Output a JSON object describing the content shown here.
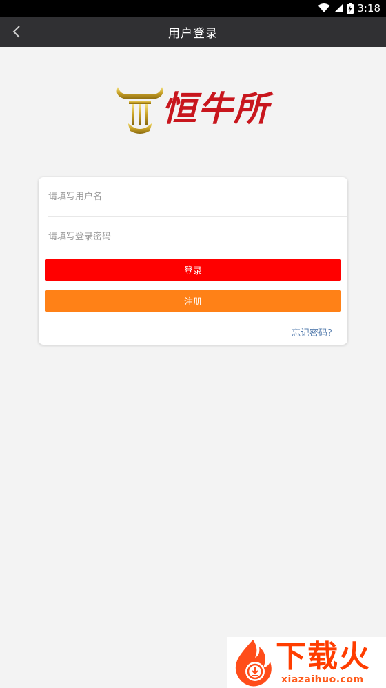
{
  "status_bar": {
    "time": "3:18"
  },
  "nav": {
    "title": "用户登录"
  },
  "brand": {
    "logo_text": "恒牛所"
  },
  "login_form": {
    "username_placeholder": "请填写用户名",
    "password_placeholder": "请填写登录密码",
    "login_label": "登录",
    "register_label": "注册",
    "forgot_label": "忘记密码？"
  },
  "watermark": {
    "cn": "下载火",
    "en": "xiazaihuo.com"
  },
  "colors": {
    "navbar": "#303033",
    "login_button": "#ff0000",
    "register_button": "#ff8117",
    "link": "#5a80b0",
    "logo_red": "#c8161d"
  }
}
